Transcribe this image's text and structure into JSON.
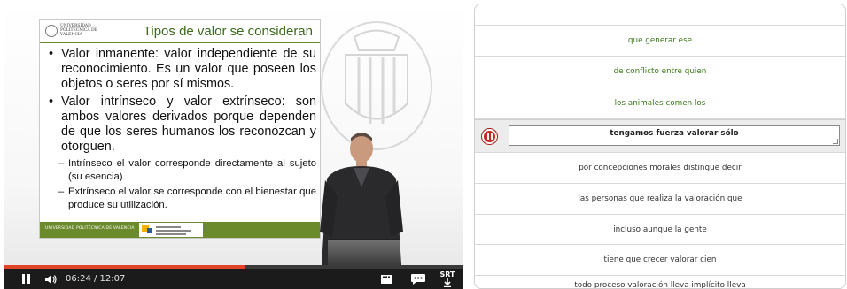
{
  "slide": {
    "logo_text": "UNIVERSIDAD POLITECNICA DE VALENCIA",
    "title": "Tipos de valor se consideran",
    "bullets": [
      "Valor inmanente: valor independiente de su reconocimiento. Es un valor que poseen los objetos o seres por sí mismos.",
      "Valor intrínseco y valor extrínseco: son ambos valores derivados porque dependen de que los seres humanos los reconozcan y otorguen."
    ],
    "sub_bullets": [
      "Intrínseco el valor corresponde directamente al sujeto (su esencia).",
      "Extrínseco el valor se corresponde con el bienestar que produce su utilización."
    ],
    "footer_text": "UNIVERSIDAD POLITÉCNICA DE VALENCIA"
  },
  "player": {
    "progress": 0.524,
    "time": "06:24 / 12:07",
    "pause_icon": "pause-icon",
    "volume_icon": "volume-icon",
    "storyboard_icon": "film-icon",
    "transcript_icon": "speech-bubble-icon",
    "srt_label": "SRT",
    "srt_icon": "download-arrow-icon",
    "accent_color": "#e0452a"
  },
  "transcript": {
    "rows": [
      {
        "text": "que generar ese",
        "style": "green"
      },
      {
        "text": "de conflicto entre quien",
        "style": "green"
      },
      {
        "text": "los animales comen los",
        "style": "green"
      },
      {
        "text": "tengamos fuerza valorar sólo",
        "style": "active"
      },
      {
        "text": "por concepciones morales distingue decir",
        "style": "normal"
      },
      {
        "text": "las personas que realiza la valoración que",
        "style": "normal"
      },
      {
        "text": "incluso aunque la gente",
        "style": "normal"
      },
      {
        "text": "tiene que crecer valorar cien",
        "style": "normal"
      },
      {
        "text": "todo proceso valoración lleva implícito lleva",
        "style": "normal"
      }
    ],
    "active_icon": "pause-circle-icon",
    "green_color": "#3b7a1b"
  }
}
